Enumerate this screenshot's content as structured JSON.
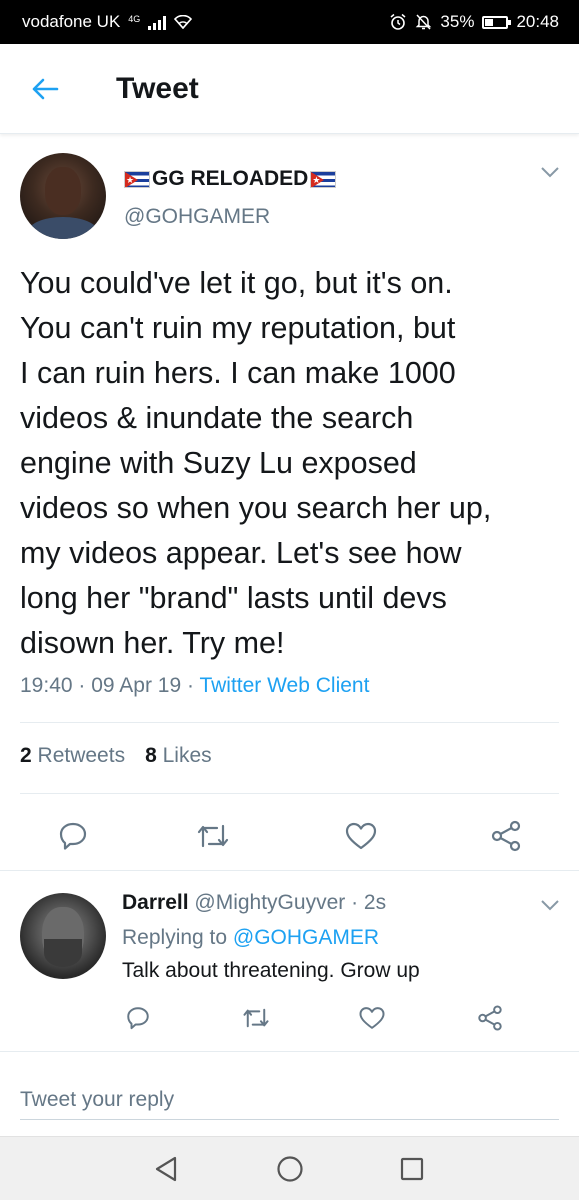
{
  "status_bar": {
    "carrier": "vodafone UK",
    "network": "4G",
    "battery_text": "35%",
    "battery_level": 0.35,
    "time": "20:48"
  },
  "header": {
    "title": "Tweet"
  },
  "tweet": {
    "display_name": "GG RELOADED",
    "handle": "@GOHGAMER",
    "text": "You could've let it go, but it's on.\nYou can't ruin my reputation, but\nI can ruin hers. I can make 1000\nvideos & inundate the search\nengine with Suzy Lu exposed\nvideos so when you search her up,\nmy videos appear. Let's see how\nlong her \"brand\" lasts until devs\ndisown her. Try me!",
    "time": "19:40",
    "date": "09 Apr 19",
    "client": "Twitter Web Client",
    "retweets_count": "2",
    "retweets_label": "Retweets",
    "likes_count": "8",
    "likes_label": "Likes"
  },
  "reply": {
    "name": "Darrell",
    "handle": "@MightyGuyver",
    "time": "2s",
    "replying_prefix": "Replying to",
    "replying_to": "@GOHGAMER",
    "text": "Talk about threatening. Grow up"
  },
  "compose": {
    "placeholder": "Tweet your reply"
  },
  "colors": {
    "accent": "#1da1f2",
    "secondary_text": "#657786",
    "primary_text": "#14171a",
    "divider": "#e6ecf0"
  },
  "icons": [
    "back-arrow-icon",
    "chevron-down-icon",
    "reply-icon",
    "retweet-icon",
    "like-icon",
    "share-icon",
    "nav-back-icon",
    "nav-home-icon",
    "nav-recents-icon"
  ]
}
